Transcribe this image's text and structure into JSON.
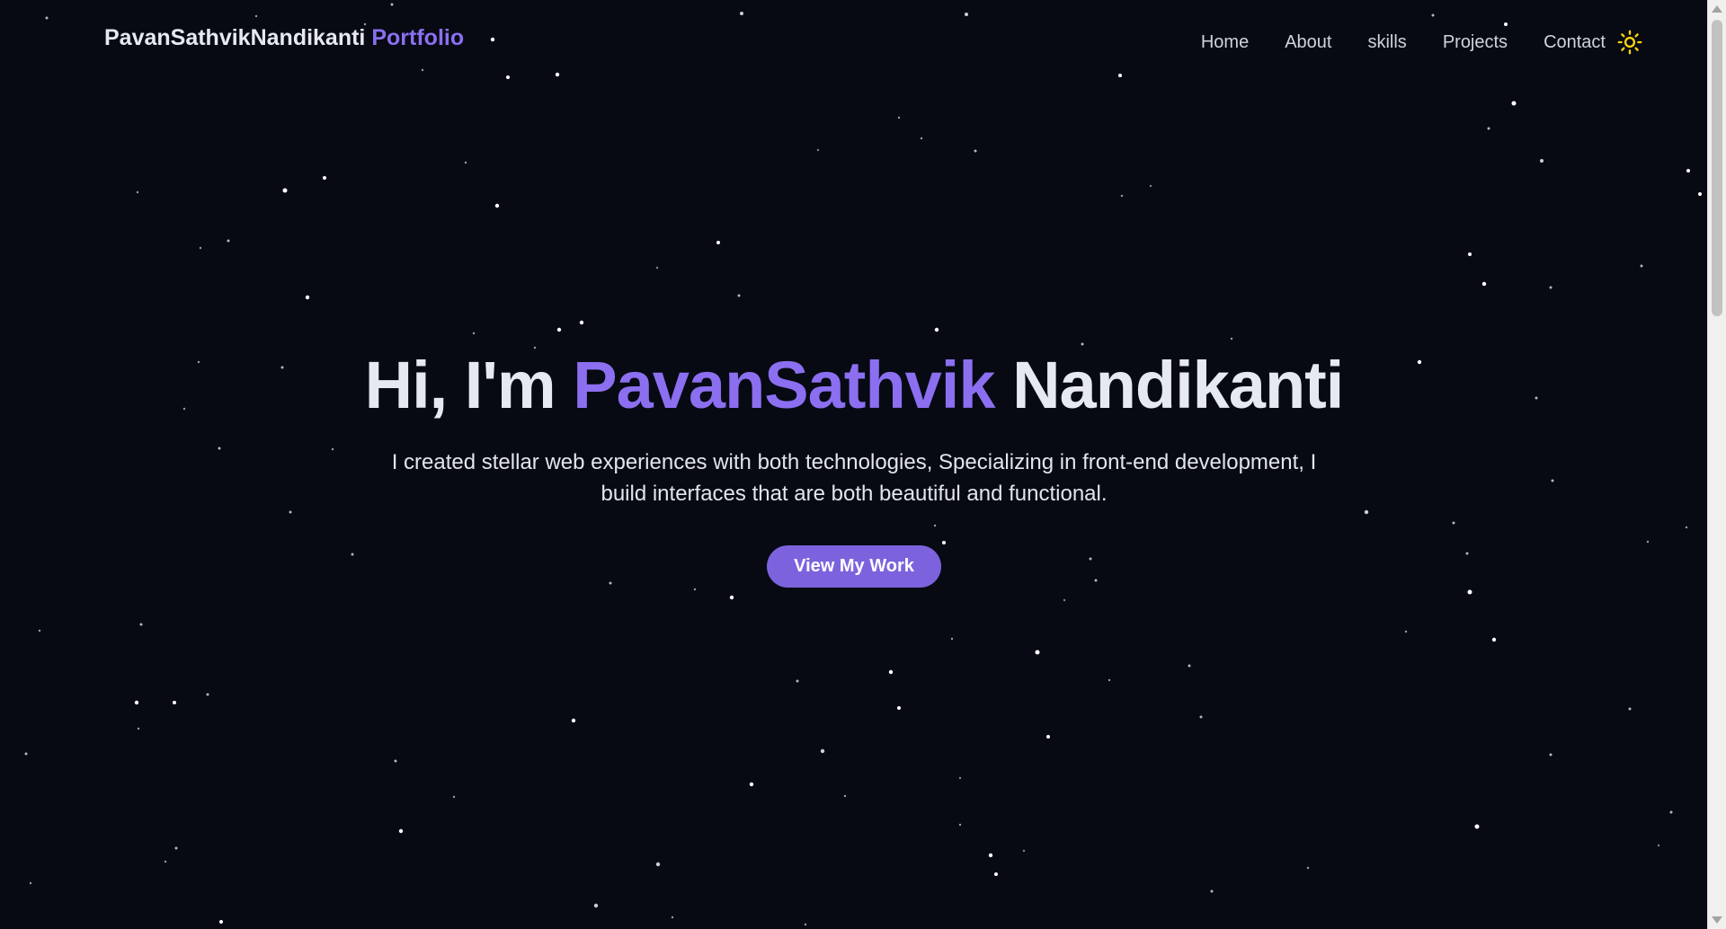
{
  "nav": {
    "logo_name": "PavanSathvikNandikanti",
    "logo_accent": "Portfolio",
    "links": [
      "Home",
      "About",
      "skills",
      "Projects",
      "Contact"
    ],
    "theme_icon": "sun-icon"
  },
  "hero": {
    "greeting": "Hi, I'm",
    "first_name": "PavanSathvik",
    "last_name": "Nandikanti",
    "subtitle": "I created stellar web experiences with both technologies, Specializing in front-end development, I build interfaces that are both beautiful and functional.",
    "cta_label": "View My Work"
  },
  "colors": {
    "background": "#070a13",
    "accent": "#8b6ff0",
    "button": "#7c63dd",
    "text": "#e6e8f2",
    "sun": "#ffd60a"
  }
}
